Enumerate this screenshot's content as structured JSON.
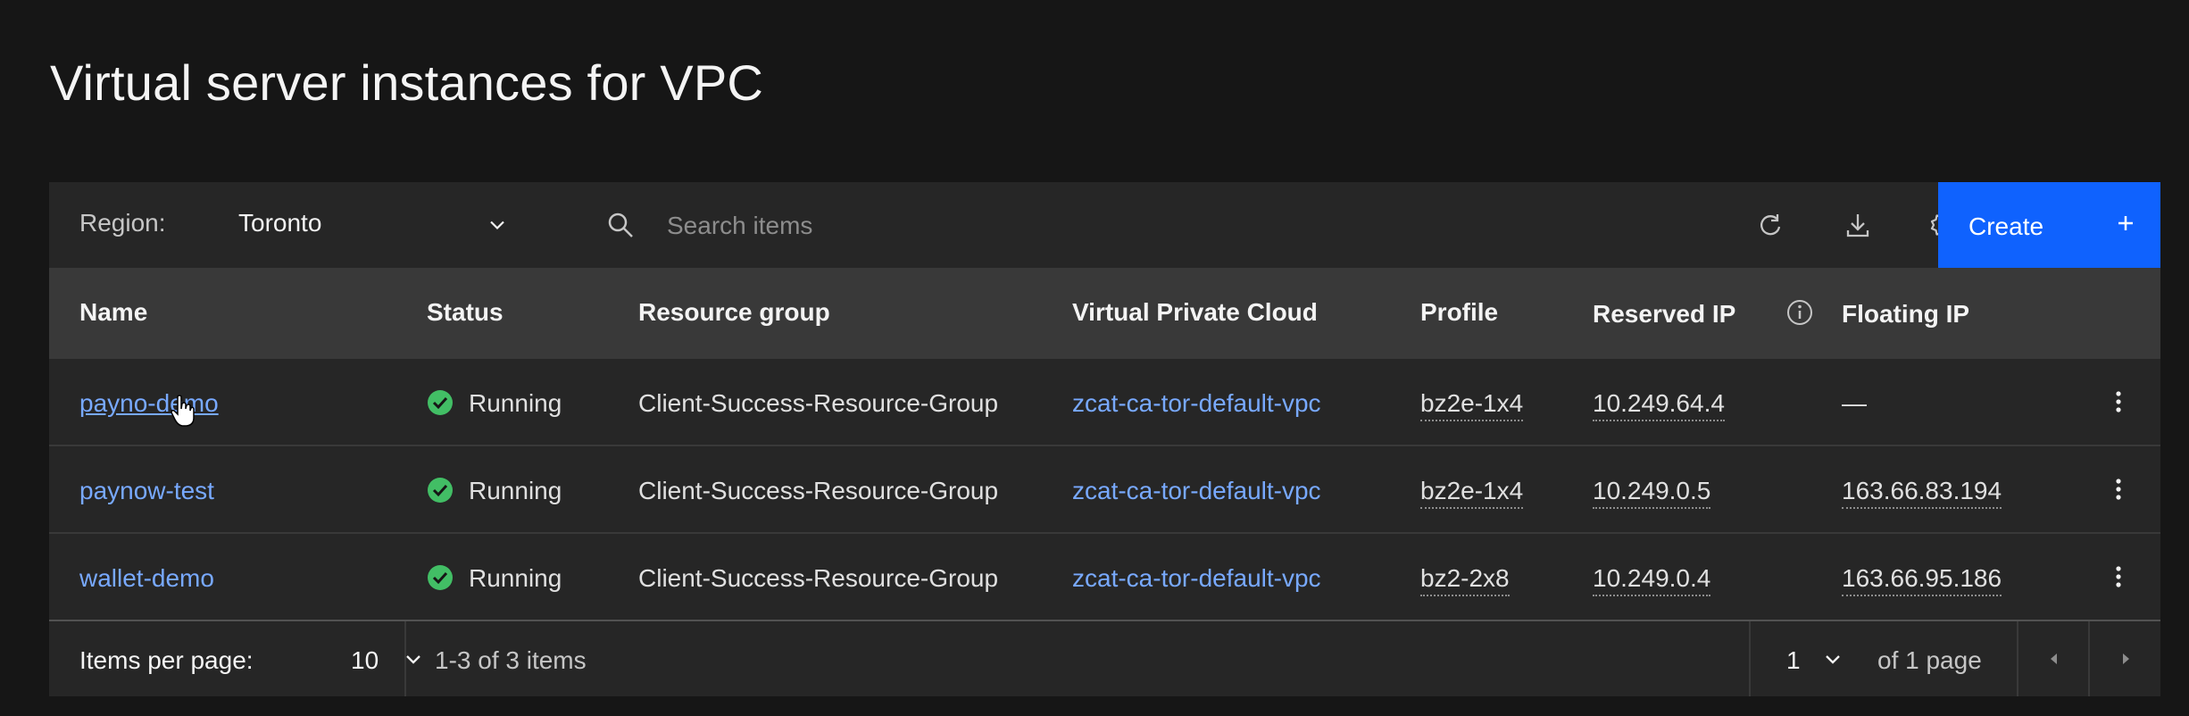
{
  "page": {
    "title": "Virtual server instances for VPC"
  },
  "toolbar": {
    "region_label": "Region:",
    "region_value": "Toronto",
    "search_placeholder": "Search items",
    "create_label": "Create",
    "icons": [
      "refresh-icon",
      "download-icon",
      "settings-icon",
      "add-icon"
    ]
  },
  "table": {
    "columns": {
      "name": "Name",
      "status": "Status",
      "resource_group": "Resource group",
      "vpc": "Virtual Private Cloud",
      "profile": "Profile",
      "reserved_ip": "Reserved IP",
      "floating_ip": "Floating IP"
    },
    "rows": [
      {
        "name": "payno-demo",
        "status": "Running",
        "resource_group": "Client-Success-Resource-Group",
        "vpc": "zcat-ca-tor-default-vpc",
        "profile": "bz2e-1x4",
        "reserved_ip": "10.249.64.4",
        "floating_ip": "—"
      },
      {
        "name": "paynow-test",
        "status": "Running",
        "resource_group": "Client-Success-Resource-Group",
        "vpc": "zcat-ca-tor-default-vpc",
        "profile": "bz2e-1x4",
        "reserved_ip": "10.249.0.5",
        "floating_ip": "163.66.83.194"
      },
      {
        "name": "wallet-demo",
        "status": "Running",
        "resource_group": "Client-Success-Resource-Group",
        "vpc": "zcat-ca-tor-default-vpc",
        "profile": "bz2-2x8",
        "reserved_ip": "10.249.0.4",
        "floating_ip": "163.66.95.186"
      }
    ]
  },
  "pagination": {
    "items_per_page_label": "Items per page:",
    "items_per_page_value": "10",
    "range_text": "1-3 of 3 items",
    "page_value": "1",
    "of_pages_text": "of 1 page"
  },
  "colors": {
    "background": "#161616",
    "card": "#262626",
    "header": "#393939",
    "accent": "#0f62fe",
    "link": "#78a9ff",
    "status_running": "#42be65"
  }
}
